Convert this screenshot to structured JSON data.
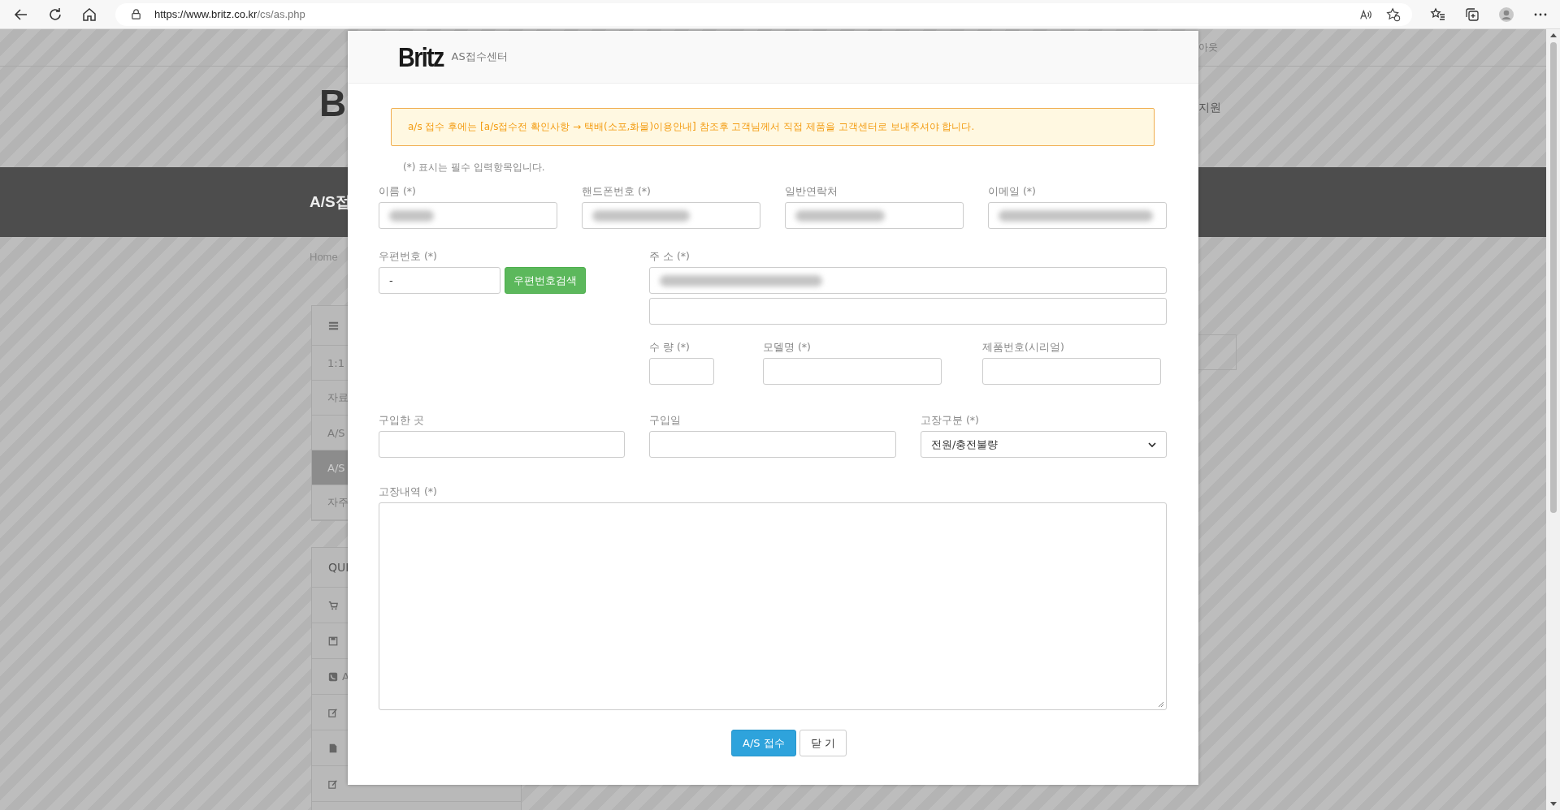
{
  "browser": {
    "url_host": "https://www.britz.co.kr",
    "url_path": "/cs/as.php"
  },
  "background_page": {
    "fragments": [
      {
        "kind": "top-link",
        "text": "아웃"
      },
      {
        "kind": "logo",
        "text": "B"
      },
      {
        "kind": "nav",
        "text": "지원"
      },
      {
        "kind": "banner-title",
        "text": "A/S접"
      },
      {
        "kind": "breadcrumb",
        "text": "Home"
      }
    ],
    "sidebar": {
      "items": [
        {
          "text": "1:1",
          "selected": false
        },
        {
          "text": "자료",
          "selected": false
        },
        {
          "text": "A/S",
          "selected": false
        },
        {
          "text": "A/S",
          "selected": true
        },
        {
          "text": "자주",
          "selected": false
        }
      ]
    },
    "quick": {
      "title": "QUI",
      "items": [
        {
          "kind": "cart"
        },
        {
          "kind": "disk"
        },
        {
          "kind": "phone",
          "text": "A"
        },
        {
          "kind": "edit"
        },
        {
          "kind": "file"
        },
        {
          "kind": "edit"
        }
      ]
    }
  },
  "modal": {
    "logo": "Britz",
    "subtitle": "AS접수센터",
    "notice": "a/s 접수 후에는 [a/s접수전 확인사항 → 택배(소포,화물)이용안내] 참조후 고객님께서 직접 제품을 고객센터로 보내주셔야 합니다.",
    "required_note": "(*) 표시는 필수 입력항목입니다.",
    "contact_fields": [
      {
        "label": "이름 (*)",
        "redacted": true
      },
      {
        "label": "핸드폰번호 (*)",
        "redacted": true
      },
      {
        "label": "일반연락처",
        "redacted": true
      },
      {
        "label": "이메일 (*)",
        "redacted": true
      }
    ],
    "zip": {
      "label": "우편번호 (*)",
      "value": "-",
      "button": "우편번호검색"
    },
    "address": {
      "label": "주 소 (*)",
      "redacted": true
    },
    "product_fields": [
      {
        "label": "수 량 (*)"
      },
      {
        "label": "모델명 (*)"
      },
      {
        "label": "제품번호(시리얼)"
      }
    ],
    "purchase_fields": [
      {
        "kind": "text",
        "label": "구입한 곳"
      },
      {
        "kind": "text",
        "label": "구입일"
      },
      {
        "kind": "select",
        "label": "고장구분 (*)",
        "value": "전원/충전불량"
      }
    ],
    "details": {
      "label": "고장내역 (*)"
    },
    "buttons": [
      {
        "kind": "primary",
        "label": "A/S 접수"
      },
      {
        "kind": "default",
        "label": "닫 기"
      }
    ]
  }
}
